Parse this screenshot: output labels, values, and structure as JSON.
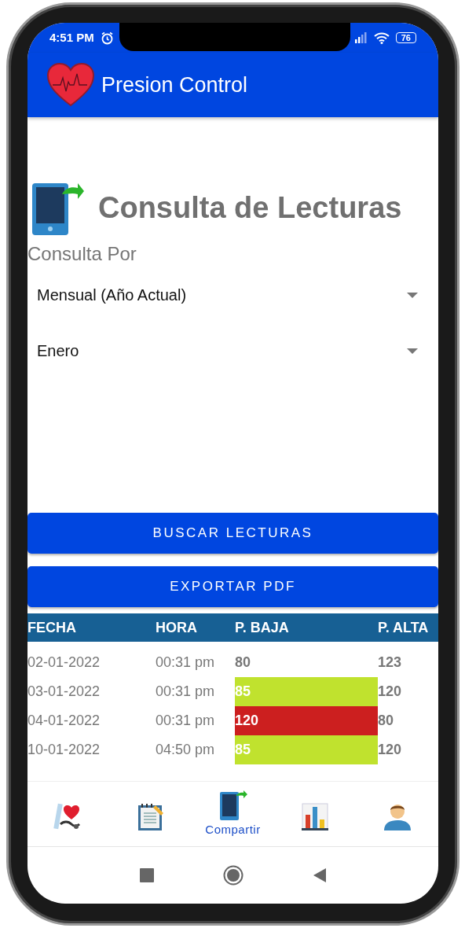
{
  "status_bar": {
    "time": "4:51 PM",
    "battery": "76"
  },
  "app_bar": {
    "title": "Presion Control"
  },
  "heading": "Consulta de Lecturas",
  "query_label": "Consulta Por",
  "dropdowns": [
    {
      "value": "Mensual (Año Actual)"
    },
    {
      "value": "Enero"
    }
  ],
  "buttons": [
    "BUSCAR LECTURAS",
    "EXPORTAR PDF"
  ],
  "table": {
    "columns": [
      "FECHA",
      "HORA",
      "P. BAJA",
      "P. ALTA"
    ],
    "rows": [
      {
        "fecha": "02-01-2022",
        "hora": "00:31 pm",
        "baja": "80",
        "alta": "123"
      },
      {
        "fecha": "03-01-2022",
        "hora": "00:31 pm",
        "baja": "85",
        "alta": "120",
        "color": "#c0e22e"
      },
      {
        "fecha": "04-01-2022",
        "hora": "00:31 pm",
        "baja": "120",
        "alta": "80",
        "color": "#cc1f1f"
      },
      {
        "fecha": "10-01-2022",
        "hora": "04:50 pm",
        "baja": "85",
        "alta": "120",
        "color": "#c0e22e"
      }
    ]
  },
  "bottom_nav": [
    {
      "selected": false
    },
    {
      "selected": false
    },
    {
      "label": "Compartir",
      "selected": true
    },
    {
      "selected": false
    },
    {
      "selected": false
    }
  ]
}
